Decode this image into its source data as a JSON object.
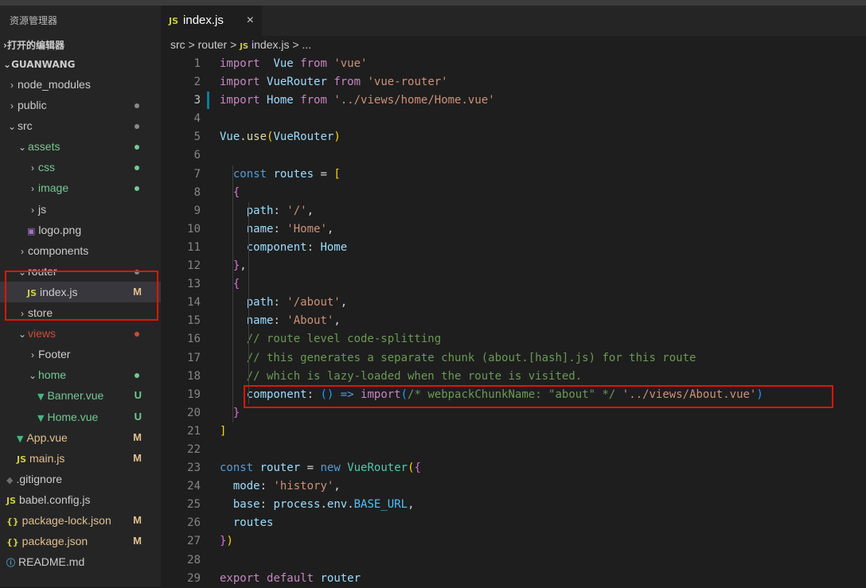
{
  "explorer": {
    "title": "资源管理器",
    "open_editors": "打开的编辑器",
    "project": "GUANWANG",
    "tree": [
      {
        "label": "node_modules",
        "indent": 0,
        "type": "folder",
        "open": false
      },
      {
        "label": "public",
        "indent": 0,
        "type": "folder",
        "open": false,
        "dot": "#8a8a8a"
      },
      {
        "label": "src",
        "indent": 0,
        "type": "folder",
        "open": true,
        "dot": "#8a8a8a"
      },
      {
        "label": "assets",
        "indent": 1,
        "type": "folder",
        "open": true,
        "dot": "#73c991",
        "color": "#73c991"
      },
      {
        "label": "css",
        "indent": 2,
        "type": "folder",
        "open": false,
        "dot": "#73c991",
        "color": "#73c991"
      },
      {
        "label": "image",
        "indent": 2,
        "type": "folder",
        "open": false,
        "dot": "#73c991",
        "color": "#73c991"
      },
      {
        "label": "js",
        "indent": 2,
        "type": "folder",
        "open": false
      },
      {
        "label": "logo.png",
        "indent": 2,
        "type": "image"
      },
      {
        "label": "components",
        "indent": 1,
        "type": "folder",
        "open": false
      },
      {
        "label": "router",
        "indent": 1,
        "type": "folder",
        "open": true,
        "dot": "#8a8a8a"
      },
      {
        "label": "index.js",
        "indent": 2,
        "type": "js",
        "badge": "M",
        "badge_color": "#e2c08d",
        "selected": true
      },
      {
        "label": "store",
        "indent": 1,
        "type": "folder",
        "open": false
      },
      {
        "label": "views",
        "indent": 1,
        "type": "folder",
        "open": true,
        "dot": "#c74e39",
        "color": "#c74e39"
      },
      {
        "label": "Footer",
        "indent": 2,
        "type": "folder",
        "open": false
      },
      {
        "label": "home",
        "indent": 2,
        "type": "folder",
        "open": true,
        "dot": "#73c991",
        "color": "#73c991"
      },
      {
        "label": "Banner.vue",
        "indent": 3,
        "type": "vue",
        "badge": "U",
        "badge_color": "#73c991",
        "color": "#73c991"
      },
      {
        "label": "Home.vue",
        "indent": 3,
        "type": "vue",
        "badge": "U",
        "badge_color": "#73c991",
        "color": "#73c991"
      },
      {
        "label": "App.vue",
        "indent": 1,
        "type": "vue",
        "badge": "M",
        "badge_color": "#e2c08d",
        "color": "#e2c08d"
      },
      {
        "label": "main.js",
        "indent": 1,
        "type": "js",
        "badge": "M",
        "badge_color": "#e2c08d",
        "color": "#e2c08d"
      },
      {
        "label": ".gitignore",
        "indent": 0,
        "type": "git"
      },
      {
        "label": "babel.config.js",
        "indent": 0,
        "type": "js"
      },
      {
        "label": "package-lock.json",
        "indent": 0,
        "type": "json",
        "badge": "M",
        "badge_color": "#e2c08d",
        "color": "#e2c08d"
      },
      {
        "label": "package.json",
        "indent": 0,
        "type": "json",
        "badge": "M",
        "badge_color": "#e2c08d",
        "color": "#e2c08d"
      },
      {
        "label": "README.md",
        "indent": 0,
        "type": "info"
      }
    ]
  },
  "tab": {
    "icon": "JS",
    "label": "index.js",
    "close": "×"
  },
  "breadcrumb": {
    "part1": "src",
    "sep": ">",
    "part2": "router",
    "icon": "JS",
    "part3": "index.js",
    "tail": "..."
  },
  "active_line": 3,
  "code": [
    {
      "n": 1,
      "t": [
        [
          "kw",
          "import"
        ],
        [
          "",
          "  "
        ],
        [
          "id",
          "Vue"
        ],
        [
          "",
          " "
        ],
        [
          "kw",
          "from"
        ],
        [
          "",
          " "
        ],
        [
          "str",
          "'vue'"
        ]
      ]
    },
    {
      "n": 2,
      "t": [
        [
          "kw",
          "import"
        ],
        [
          "",
          " "
        ],
        [
          "id",
          "VueRouter"
        ],
        [
          "",
          " "
        ],
        [
          "kw",
          "from"
        ],
        [
          "",
          " "
        ],
        [
          "str",
          "'vue-router'"
        ]
      ]
    },
    {
      "n": 3,
      "t": [
        [
          "kw",
          "import"
        ],
        [
          "",
          " "
        ],
        [
          "id",
          "Home"
        ],
        [
          "",
          " "
        ],
        [
          "kw",
          "from"
        ],
        [
          "",
          " "
        ],
        [
          "str",
          "'../views/home/Home.vue'"
        ]
      ]
    },
    {
      "n": 4,
      "t": []
    },
    {
      "n": 5,
      "t": [
        [
          "id",
          "Vue"
        ],
        [
          "",
          "."
        ],
        [
          "fn",
          "use"
        ],
        [
          "br",
          "("
        ],
        [
          "id",
          "VueRouter"
        ],
        [
          "br",
          ")"
        ]
      ]
    },
    {
      "n": 6,
      "t": []
    },
    {
      "n": 7,
      "t": [
        [
          "",
          "  "
        ],
        [
          "kw2",
          "const"
        ],
        [
          "",
          " "
        ],
        [
          "id",
          "routes"
        ],
        [
          "",
          " = "
        ],
        [
          "br",
          "["
        ]
      ]
    },
    {
      "n": 8,
      "t": [
        [
          "",
          "  "
        ],
        [
          "br2",
          "{"
        ]
      ]
    },
    {
      "n": 9,
      "t": [
        [
          "",
          "    "
        ],
        [
          "id",
          "path"
        ],
        [
          "",
          ": "
        ],
        [
          "str",
          "'/'"
        ],
        [
          "",
          ","
        ]
      ]
    },
    {
      "n": 10,
      "t": [
        [
          "",
          "    "
        ],
        [
          "id",
          "name"
        ],
        [
          "",
          ": "
        ],
        [
          "str",
          "'Home'"
        ],
        [
          "",
          ","
        ]
      ]
    },
    {
      "n": 11,
      "t": [
        [
          "",
          "    "
        ],
        [
          "id",
          "component"
        ],
        [
          "",
          ": "
        ],
        [
          "id",
          "Home"
        ]
      ]
    },
    {
      "n": 12,
      "t": [
        [
          "",
          "  "
        ],
        [
          "br2",
          "}"
        ],
        [
          "",
          ","
        ]
      ]
    },
    {
      "n": 13,
      "t": [
        [
          "",
          "  "
        ],
        [
          "br2",
          "{"
        ]
      ]
    },
    {
      "n": 14,
      "t": [
        [
          "",
          "    "
        ],
        [
          "id",
          "path"
        ],
        [
          "",
          ": "
        ],
        [
          "str",
          "'/about'"
        ],
        [
          "",
          ","
        ]
      ]
    },
    {
      "n": 15,
      "t": [
        [
          "",
          "    "
        ],
        [
          "id",
          "name"
        ],
        [
          "",
          ": "
        ],
        [
          "str",
          "'About'"
        ],
        [
          "",
          ","
        ]
      ]
    },
    {
      "n": 16,
      "t": [
        [
          "",
          "    "
        ],
        [
          "cm",
          "// route level code-splitting"
        ]
      ]
    },
    {
      "n": 17,
      "t": [
        [
          "",
          "    "
        ],
        [
          "cm",
          "// this generates a separate chunk (about.[hash].js) for this route"
        ]
      ]
    },
    {
      "n": 18,
      "t": [
        [
          "",
          "    "
        ],
        [
          "cm",
          "// which is lazy-loaded when the route is visited."
        ]
      ]
    },
    {
      "n": 19,
      "t": [
        [
          "",
          "    "
        ],
        [
          "id",
          "component"
        ],
        [
          "",
          ": "
        ],
        [
          "br3",
          "()"
        ],
        [
          "",
          " "
        ],
        [
          "kw2",
          "=>"
        ],
        [
          "",
          " "
        ],
        [
          "kw",
          "import"
        ],
        [
          "br3",
          "("
        ],
        [
          "cm",
          "/* webpackChunkName: \"about\" */"
        ],
        [
          "",
          " "
        ],
        [
          "str",
          "'../views/About.vue'"
        ],
        [
          "br3",
          ")"
        ]
      ]
    },
    {
      "n": 20,
      "t": [
        [
          "",
          "  "
        ],
        [
          "br2",
          "}"
        ]
      ]
    },
    {
      "n": 21,
      "t": [
        [
          "br",
          "]"
        ]
      ]
    },
    {
      "n": 22,
      "t": []
    },
    {
      "n": 23,
      "t": [
        [
          "kw2",
          "const"
        ],
        [
          "",
          " "
        ],
        [
          "id",
          "router"
        ],
        [
          "",
          " = "
        ],
        [
          "kw2",
          "new"
        ],
        [
          "",
          " "
        ],
        [
          "cls",
          "VueRouter"
        ],
        [
          "br",
          "("
        ],
        [
          "br2",
          "{"
        ]
      ]
    },
    {
      "n": 24,
      "t": [
        [
          "",
          "  "
        ],
        [
          "id",
          "mode"
        ],
        [
          "",
          ": "
        ],
        [
          "str",
          "'history'"
        ],
        [
          "",
          ","
        ]
      ]
    },
    {
      "n": 25,
      "t": [
        [
          "",
          "  "
        ],
        [
          "id",
          "base"
        ],
        [
          "",
          ": "
        ],
        [
          "id",
          "process"
        ],
        [
          "",
          "."
        ],
        [
          "id",
          "env"
        ],
        [
          "",
          "."
        ],
        [
          "cn",
          "BASE_URL"
        ],
        [
          "",
          ","
        ]
      ]
    },
    {
      "n": 26,
      "t": [
        [
          "",
          "  "
        ],
        [
          "id",
          "routes"
        ]
      ]
    },
    {
      "n": 27,
      "t": [
        [
          "br2",
          "}"
        ],
        [
          "br",
          ")"
        ]
      ]
    },
    {
      "n": 28,
      "t": []
    },
    {
      "n": 29,
      "t": [
        [
          "kw",
          "export"
        ],
        [
          "",
          " "
        ],
        [
          "kw",
          "default"
        ],
        [
          "",
          " "
        ],
        [
          "id",
          "router"
        ]
      ]
    }
  ]
}
